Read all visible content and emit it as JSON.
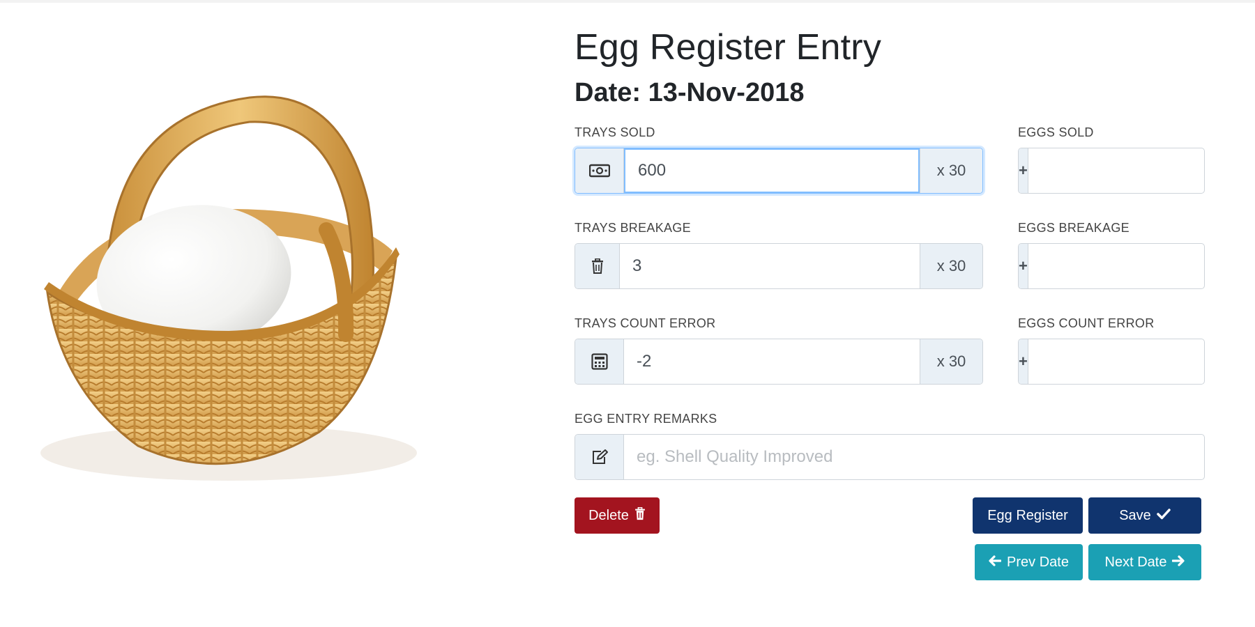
{
  "header": {
    "title": "Egg Register Entry",
    "date_label": "Date: 13-Nov-2018"
  },
  "illustration": {
    "name": "egg-basket-image"
  },
  "form": {
    "trays_sold": {
      "label": "TRAYS SOLD",
      "value": "600",
      "suffix": "x 30",
      "icon": "money-icon"
    },
    "eggs_sold": {
      "label": "EGGS SOLD",
      "value": "",
      "icon": "plus-icon"
    },
    "trays_breakage": {
      "label": "TRAYS BREAKAGE",
      "value": "3",
      "suffix": "x 30",
      "icon": "trash-icon"
    },
    "eggs_breakage": {
      "label": "EGGS BREAKAGE",
      "value": "",
      "icon": "plus-icon"
    },
    "trays_count_error": {
      "label": "TRAYS COUNT ERROR",
      "value": "-2",
      "suffix": "x 30",
      "icon": "calculator-icon"
    },
    "eggs_count_error": {
      "label": "EGGS COUNT ERROR",
      "value": "",
      "icon": "plus-icon"
    },
    "remarks": {
      "label": "EGG ENTRY REMARKS",
      "value": "",
      "placeholder": "eg. Shell Quality Improved",
      "icon": "edit-icon"
    }
  },
  "buttons": {
    "delete": "Delete",
    "egg_register": "Egg Register",
    "save": "Save",
    "prev_date": "Prev Date",
    "next_date": "Next Date"
  },
  "colors": {
    "danger": "#a3141f",
    "navy": "#10346e",
    "teal": "#1ba0b4",
    "addon_bg": "#e9f0f6",
    "focus": "#80bdff"
  }
}
